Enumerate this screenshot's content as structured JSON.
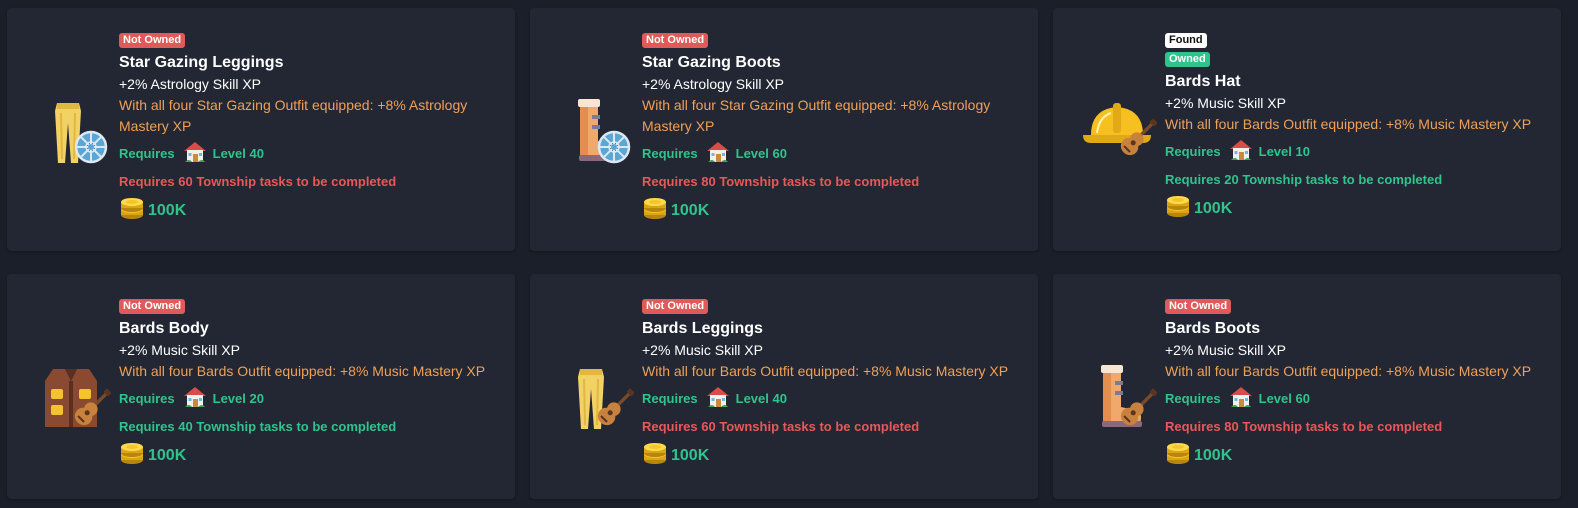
{
  "cards": [
    {
      "status": [
        "Not Owned"
      ],
      "name": "Star Gazing Leggings",
      "skill": "+2% Astrology Skill XP",
      "set_bonus": "With all four Star Gazing Outfit equipped: +8% Astrology Mastery XP",
      "requires_label": "Requires",
      "level": "Level 40",
      "tasks": "Requires 60 Township tasks to be completed",
      "tasks_met": false,
      "price": "100K",
      "icon": "leggings-icon",
      "tool": "wheel"
    },
    {
      "status": [
        "Not Owned"
      ],
      "name": "Star Gazing Boots",
      "skill": "+2% Astrology Skill XP",
      "set_bonus": "With all four Star Gazing Outfit equipped: +8% Astrology Mastery XP",
      "requires_label": "Requires",
      "level": "Level 60",
      "tasks": "Requires 80 Township tasks to be completed",
      "tasks_met": false,
      "price": "100K",
      "icon": "boots-icon",
      "tool": "wheel"
    },
    {
      "status": [
        "Found",
        "Owned"
      ],
      "name": "Bards Hat",
      "skill": "+2% Music Skill XP",
      "set_bonus": "With all four Bards Outfit equipped: +8% Music Mastery XP",
      "requires_label": "Requires",
      "level": "Level 10",
      "tasks": "Requires 20 Township tasks to be completed",
      "tasks_met": true,
      "price": "100K",
      "icon": "hat-icon",
      "tool": "guitar"
    },
    {
      "status": [
        "Not Owned"
      ],
      "name": "Bards Body",
      "skill": "+2% Music Skill XP",
      "set_bonus": "With all four Bards Outfit equipped: +8% Music Mastery XP",
      "requires_label": "Requires",
      "level": "Level 20",
      "tasks": "Requires 40 Township tasks to be completed",
      "tasks_met": true,
      "price": "100K",
      "icon": "vest-icon",
      "tool": "guitar"
    },
    {
      "status": [
        "Not Owned"
      ],
      "name": "Bards Leggings",
      "skill": "+2% Music Skill XP",
      "set_bonus": "With all four Bards Outfit equipped: +8% Music Mastery XP",
      "requires_label": "Requires",
      "level": "Level 40",
      "tasks": "Requires 60 Township tasks to be completed",
      "tasks_met": false,
      "price": "100K",
      "icon": "leggings-icon",
      "tool": "guitar"
    },
    {
      "status": [
        "Not Owned"
      ],
      "name": "Bards Boots",
      "skill": "+2% Music Skill XP",
      "set_bonus": "With all four Bards Outfit equipped: +8% Music Mastery XP",
      "requires_label": "Requires",
      "level": "Level 60",
      "tasks": "Requires 80 Township tasks to be completed",
      "tasks_met": false,
      "price": "100K",
      "icon": "boots-icon",
      "tool": "guitar"
    }
  ],
  "colors": {
    "background": "#1b1f29",
    "card": "#222733",
    "green": "#30c48d",
    "red": "#e8585a",
    "orange": "#f0a057",
    "not_owned_badge": "#e05a5a"
  }
}
